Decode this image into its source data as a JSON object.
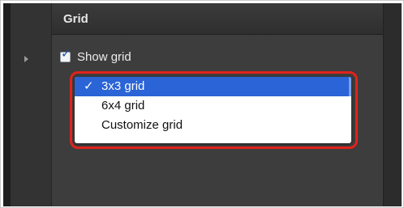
{
  "panel": {
    "title": "Grid",
    "show_grid_label": "Show grid",
    "show_grid_checked": true
  },
  "dropdown": {
    "items": [
      {
        "label": "3x3 grid",
        "selected": true,
        "check": "✓"
      },
      {
        "label": "6x4 grid",
        "selected": false
      },
      {
        "label": "Customize grid",
        "selected": false
      }
    ]
  },
  "colors": {
    "accent": "#2a64d6",
    "highlight": "#e0231b"
  }
}
